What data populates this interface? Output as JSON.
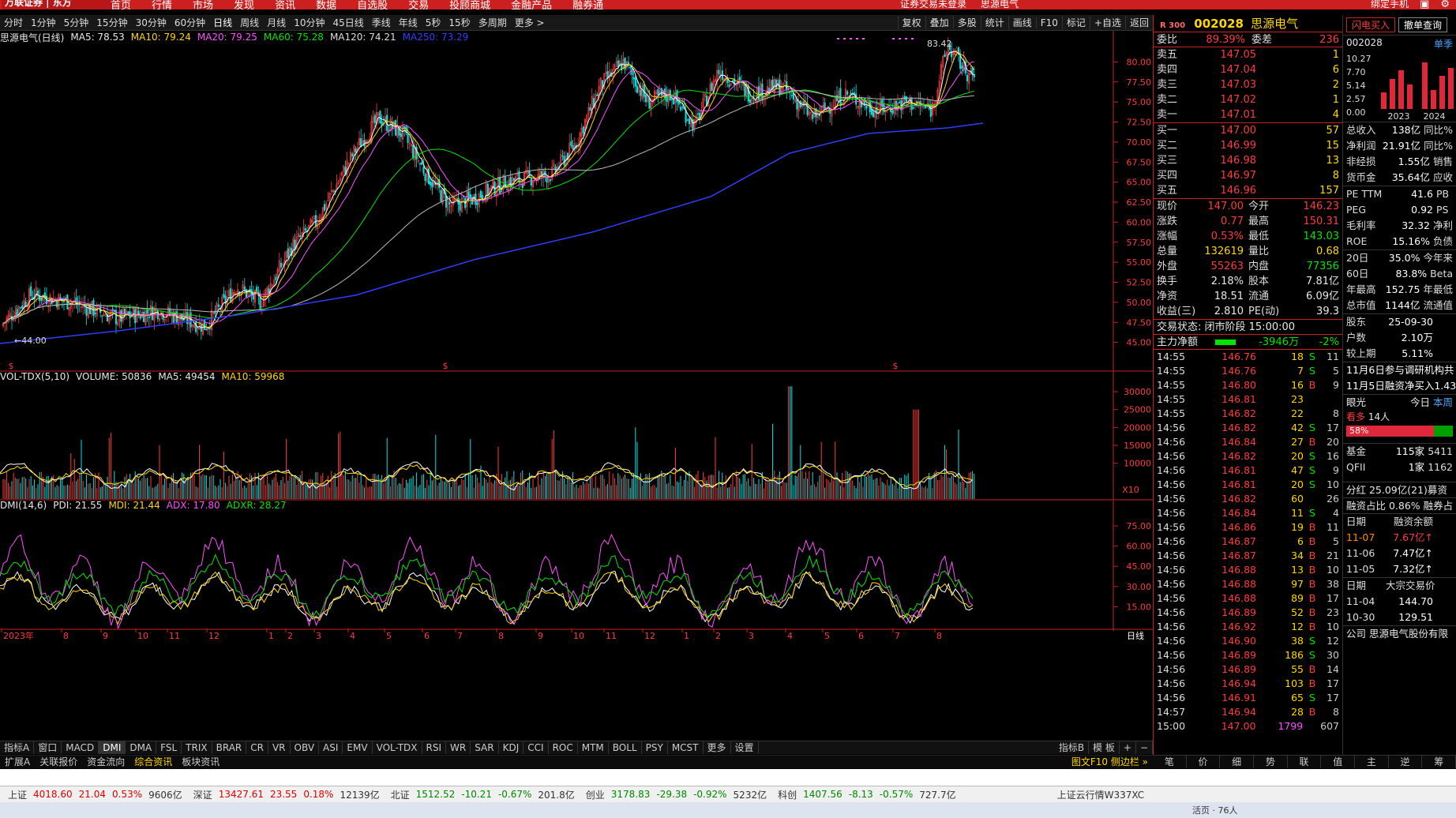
{
  "topbar": {
    "logo": "万联证券 | 东方",
    "nav": [
      "首页",
      "行情",
      "市场",
      "发现",
      "资讯",
      "数据",
      "自选股",
      "交易",
      "投顾商城",
      "金融产品",
      "融券通"
    ],
    "status": [
      "证券交易未登录",
      "思源电气"
    ],
    "right": "绑定手机"
  },
  "periods": [
    "分时",
    "1分钟",
    "5分钟",
    "15分钟",
    "30分钟",
    "60分钟",
    "日线",
    "周线",
    "月线",
    "10分钟",
    "45日线",
    "季线",
    "年线",
    "5秒",
    "15秒",
    "多周期",
    "更多 >"
  ],
  "period_active": "日线",
  "tools": [
    "复权",
    "叠加",
    "多股",
    "统计",
    "画线",
    "F10",
    "标记",
    "+自选",
    "返回"
  ],
  "main_legend": {
    "name": "思源电气(日线)",
    "ma5": "MA5: 78.53",
    "ma10": "MA10: 79.24",
    "ma20": "MA20: 79.25",
    "ma60": "MA60: 75.28",
    "ma120": "MA120: 74.21",
    "ma250": "MA250: 73.29"
  },
  "price_axis": [
    "80.00",
    "77.50",
    "75.00",
    "72.50",
    "70.00",
    "67.50",
    "65.00",
    "62.50",
    "60.00",
    "57.50",
    "55.00",
    "52.50",
    "50.00",
    "47.50",
    "45.00"
  ],
  "annot_low": "←44.00",
  "annot_high": "83.42",
  "vol_legend": {
    "name": "VOL-TDX(5,10)",
    "volume": "VOLUME: 50836",
    "ma5": "MA5: 49454",
    "ma10": "MA10: 59968"
  },
  "vol_axis": [
    "30000",
    "25000",
    "20000",
    "15000",
    "10000"
  ],
  "vol_unit": "X10",
  "dmi_legend": {
    "name": "DMI(14,6)",
    "pdi": "PDI: 21.55",
    "mdi": "MDI: 21.44",
    "adx": "ADX: 17.80",
    "adxr": "ADXR: 28.27"
  },
  "dmi_axis": [
    "75.00",
    "60.00",
    "45.00",
    "30.00",
    "15.00"
  ],
  "x_labels": [
    [
      "2023年",
      2
    ],
    [
      "8",
      78
    ],
    [
      "9",
      128
    ],
    [
      "10",
      172
    ],
    [
      "11",
      212
    ],
    [
      "12",
      262
    ],
    [
      "1",
      338
    ],
    [
      "2",
      362
    ],
    [
      "3",
      398
    ],
    [
      "4",
      441
    ],
    [
      "5",
      487
    ],
    [
      "6",
      535
    ],
    [
      "7",
      577
    ],
    [
      "8",
      629
    ],
    [
      "9",
      679
    ],
    [
      "10",
      724
    ],
    [
      "11",
      765
    ],
    [
      "12",
      814
    ],
    [
      "1",
      864
    ],
    [
      "2",
      904
    ],
    [
      "3",
      946
    ],
    [
      "4",
      995
    ],
    [
      "5",
      1042
    ],
    [
      "6",
      1085
    ],
    [
      "7",
      1131
    ],
    [
      "8",
      1184
    ]
  ],
  "x_right": "日线",
  "indicators": [
    "指标A",
    "窗口",
    "MACD",
    "DMI",
    "DMA",
    "FSL",
    "TRIX",
    "BRAR",
    "CR",
    "VR",
    "OBV",
    "ASI",
    "EMV",
    "VOL-TDX",
    "RSI",
    "WR",
    "SAR",
    "KDJ",
    "CCI",
    "ROC",
    "MTM",
    "BOLL",
    "PSY",
    "MCST",
    "更多",
    "设置"
  ],
  "indicator_active": "DMI",
  "indicator_right": [
    "指标B",
    "模 板",
    "+",
    "−"
  ],
  "tabs": [
    "扩展A",
    "关联报价",
    "资金流向",
    "综合资讯",
    "板块资讯"
  ],
  "tabs_right": "图文F10 侧边栏 »",
  "quote": {
    "code": "002028",
    "name": "思源电气",
    "tag": "R 300",
    "weibi_label": "委比",
    "weibi": "89.39%",
    "weicha_label": "委差",
    "weicha": "236",
    "sells": [
      [
        "卖五",
        "147.05",
        "1"
      ],
      [
        "卖四",
        "147.04",
        "6"
      ],
      [
        "卖三",
        "147.03",
        "2"
      ],
      [
        "卖二",
        "147.02",
        "1"
      ],
      [
        "卖一",
        "147.01",
        "4"
      ]
    ],
    "buys": [
      [
        "买一",
        "147.00",
        "57"
      ],
      [
        "买二",
        "146.99",
        "15"
      ],
      [
        "买三",
        "146.98",
        "13"
      ],
      [
        "买四",
        "146.97",
        "8"
      ],
      [
        "买五",
        "146.96",
        "157"
      ]
    ],
    "stats": [
      [
        "现价",
        "147.00",
        "今开",
        "146.23"
      ],
      [
        "涨跌",
        "0.77",
        "最高",
        "150.31"
      ],
      [
        "涨幅",
        "0.53%",
        "最低",
        "143.03"
      ],
      [
        "总量",
        "132619",
        "量比",
        "0.68"
      ],
      [
        "外盘",
        "55263",
        "内盘",
        "77356"
      ],
      [
        "换手",
        "2.18%",
        "股本",
        "7.81亿"
      ],
      [
        "净资",
        "18.51",
        "流通",
        "6.09亿"
      ],
      [
        "收益(三)",
        "2.810",
        "PE(动)",
        "39.3"
      ]
    ],
    "trade_status": "交易状态: 闭市阶段 15:00:00",
    "flow_label": "主力净额",
    "flow_value": "-3946万",
    "flow_pct": "-2%"
  },
  "ticks": [
    [
      "14:55",
      "146.76",
      "18",
      "S",
      "11"
    ],
    [
      "14:55",
      "146.76",
      "7",
      "S",
      "5"
    ],
    [
      "14:55",
      "146.80",
      "16",
      "B",
      "9"
    ],
    [
      "14:55",
      "146.81",
      "23",
      "",
      ""
    ],
    [
      "14:55",
      "146.82",
      "22",
      "",
      "8"
    ],
    [
      "14:56",
      "146.82",
      "42",
      "S",
      "17"
    ],
    [
      "14:56",
      "146.84",
      "27",
      "B",
      "20"
    ],
    [
      "14:56",
      "146.82",
      "20",
      "S",
      "16"
    ],
    [
      "14:56",
      "146.81",
      "47",
      "S",
      "9"
    ],
    [
      "14:56",
      "146.81",
      "20",
      "S",
      "10"
    ],
    [
      "14:56",
      "146.82",
      "60",
      "",
      "26"
    ],
    [
      "14:56",
      "146.84",
      "11",
      "S",
      "4"
    ],
    [
      "14:56",
      "146.86",
      "19",
      "B",
      "11"
    ],
    [
      "14:56",
      "146.87",
      "6",
      "B",
      "5"
    ],
    [
      "14:56",
      "146.87",
      "34",
      "B",
      "21"
    ],
    [
      "14:56",
      "146.88",
      "13",
      "B",
      "10"
    ],
    [
      "14:56",
      "146.88",
      "97",
      "B",
      "38"
    ],
    [
      "14:56",
      "146.88",
      "89",
      "B",
      "17"
    ],
    [
      "14:56",
      "146.89",
      "52",
      "B",
      "23"
    ],
    [
      "14:56",
      "146.92",
      "12",
      "B",
      "10"
    ],
    [
      "14:56",
      "146.90",
      "38",
      "S",
      "12"
    ],
    [
      "14:56",
      "146.89",
      "186",
      "S",
      "30"
    ],
    [
      "14:56",
      "146.89",
      "55",
      "B",
      "14"
    ],
    [
      "14:56",
      "146.94",
      "103",
      "B",
      "17"
    ],
    [
      "14:56",
      "146.91",
      "65",
      "S",
      "17"
    ],
    [
      "14:57",
      "146.94",
      "28",
      "B",
      "8"
    ],
    [
      "15:00",
      "147.00",
      "1799",
      "",
      "607"
    ]
  ],
  "side": {
    "btn1": "闪电买入",
    "btn2": "撤单查询",
    "code": "002028",
    "mode": "单季",
    "yaxis": [
      "10.27",
      "7.70",
      "5.14",
      "2.57",
      "0.00"
    ],
    "years": [
      "2023",
      "2024"
    ],
    "fin": [
      [
        "总收入",
        "138亿",
        "同比%"
      ],
      [
        "净利润",
        "21.91亿",
        "同比%"
      ],
      [
        "非经损",
        "1.55亿",
        "销售"
      ],
      [
        "货币金",
        "35.64亿",
        "应收"
      ]
    ],
    "val": [
      [
        "PE TTM",
        "41.6",
        "PB"
      ],
      [
        "PEG",
        "0.92",
        "PS"
      ],
      [
        "毛利率",
        "32.32",
        "净利"
      ],
      [
        "ROE",
        "15.16%",
        "负债"
      ]
    ],
    "perf": [
      [
        "20日",
        "35.0%",
        "今年来"
      ],
      [
        "60日",
        "83.8%",
        "Beta"
      ],
      [
        "年最高",
        "152.75",
        "年最低"
      ],
      [
        "总市值",
        "1144亿",
        "流通值"
      ]
    ],
    "hold": [
      [
        "股东",
        "25-09-30"
      ],
      [
        "户数",
        "2.10万"
      ],
      [
        "较上期",
        "5.11%"
      ]
    ],
    "news": [
      "11月6日参与调研机构共",
      "11月5日融资净买入1.43"
    ],
    "eye": "眼光",
    "today": "今日",
    "week": "本周",
    "kan": "看多",
    "kan_n": "14人",
    "kan_pct": "58%",
    "fund": [
      [
        "基金",
        "115家",
        "5411"
      ],
      [
        "QFII",
        "1家",
        "1162"
      ]
    ],
    "div": "分红 25.09亿(21)募资",
    "margin": "融资占比 0.86% 融券占",
    "mhdr": [
      "日期",
      "融资余额"
    ],
    "mrows": [
      [
        "11-07",
        "7.67亿↑"
      ],
      [
        "11-06",
        "7.47亿↑"
      ],
      [
        "11-05",
        "7.32亿↑"
      ]
    ],
    "bhdr": [
      "日期",
      "大宗交易价"
    ],
    "brows": [
      [
        "11-04",
        "144.70"
      ],
      [
        "10-30",
        "129.51"
      ]
    ],
    "corp": "公司 思源电气股份有限"
  },
  "side_tabs": [
    "笔",
    "价",
    "细",
    "势",
    "联",
    "值",
    "主",
    "逆",
    "筹"
  ],
  "bottom": [
    [
      "上证",
      "4018.60",
      "21.04",
      "0.53%",
      "9606亿"
    ],
    [
      "深证",
      "13427.61",
      "23.55",
      "0.18%",
      "12139亿"
    ],
    [
      "北证",
      "1512.52",
      "-10.21",
      "-0.67%",
      "201.8亿"
    ],
    [
      "创业",
      "3178.83",
      "-29.38",
      "-0.92%",
      "5232亿"
    ],
    [
      "科创",
      "1407.56",
      "-8.13",
      "-0.57%",
      "727.7亿"
    ]
  ],
  "bottom_right": "上证云行情W337XC",
  "taskbar_note": "活页 · 76人",
  "colors": {
    "up": "#ff3c3c",
    "down": "#00e600",
    "accent": "#cc1f1f",
    "yellow": "#ffd700"
  }
}
